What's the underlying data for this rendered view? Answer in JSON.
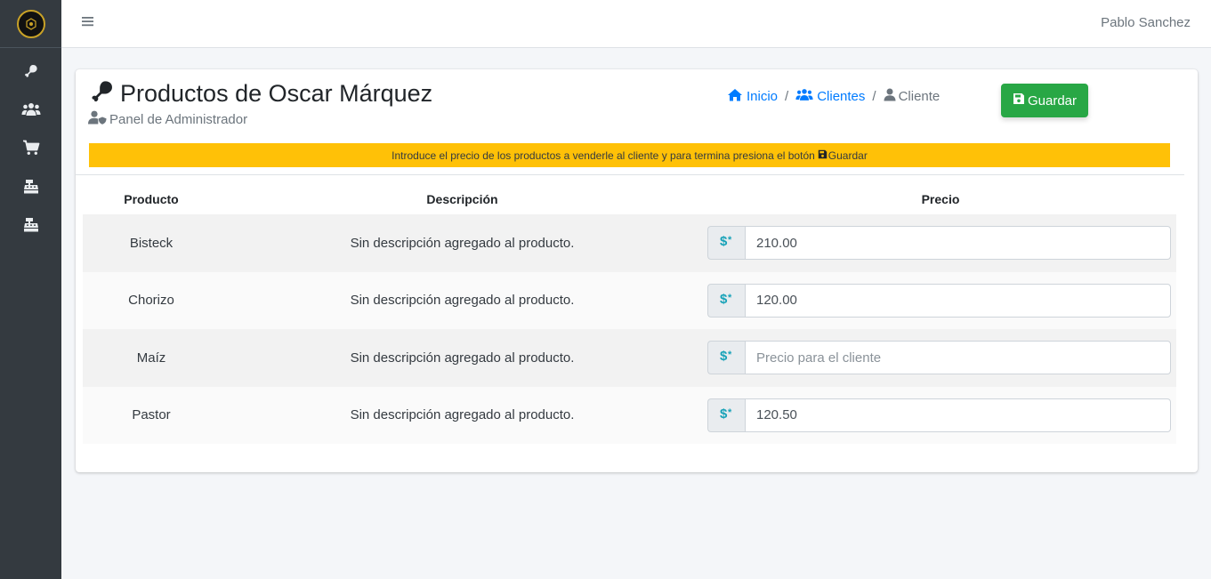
{
  "topbar": {
    "user_name": "Pablo Sanchez"
  },
  "sidebar": {
    "items": [
      "drumstick-icon",
      "users-icon",
      "cart-icon",
      "cash-register-icon",
      "cash-register-icon-2"
    ]
  },
  "page": {
    "title": "Productos de Oscar Márquez",
    "subtitle": "Panel de Administrador"
  },
  "breadcrumb": {
    "home": "Inicio",
    "clients": "Clientes",
    "current": "Cliente"
  },
  "save_label": "Guardar",
  "alert": {
    "text": "Introduce el precio de los productos a venderle al cliente y para termina presiona el botón",
    "button_ref": "Guardar"
  },
  "table": {
    "headers": {
      "product": "Producto",
      "description": "Descripción",
      "price": "Precio"
    },
    "rows": [
      {
        "product": "Bisteck",
        "description": "Sin descripción agregado al producto.",
        "price": "210.00",
        "placeholder": "Precio para el cliente"
      },
      {
        "product": "Chorizo",
        "description": "Sin descripción agregado al producto.",
        "price": "120.00",
        "placeholder": "Precio para el cliente"
      },
      {
        "product": "Maíz",
        "description": "Sin descripción agregado al producto.",
        "price": "",
        "placeholder": "Precio para el cliente"
      },
      {
        "product": "Pastor",
        "description": "Sin descripción agregado al producto.",
        "price": "120.50",
        "placeholder": "Precio para el cliente"
      }
    ]
  },
  "colors": {
    "sidebar": "#343a40",
    "primary": "#007bff",
    "success": "#28a745",
    "warning": "#ffc107",
    "prepend_icon": "#17a2b8"
  }
}
